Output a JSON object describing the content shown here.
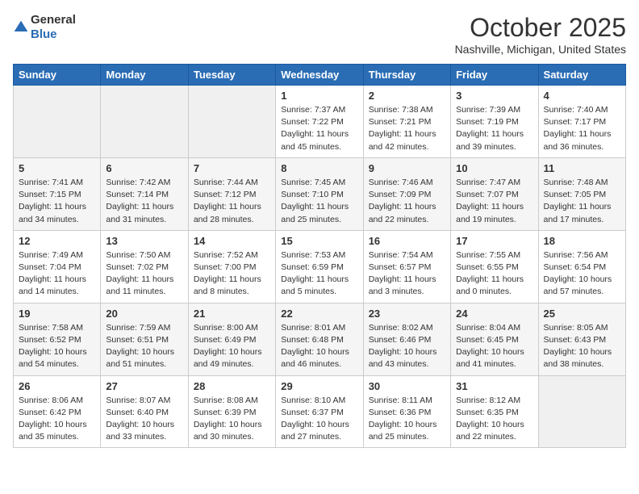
{
  "header": {
    "logo_general": "General",
    "logo_blue": "Blue",
    "month_title": "October 2025",
    "location": "Nashville, Michigan, United States"
  },
  "weekdays": [
    "Sunday",
    "Monday",
    "Tuesday",
    "Wednesday",
    "Thursday",
    "Friday",
    "Saturday"
  ],
  "weeks": [
    [
      {
        "day": "",
        "sunrise": "",
        "sunset": "",
        "daylight": ""
      },
      {
        "day": "",
        "sunrise": "",
        "sunset": "",
        "daylight": ""
      },
      {
        "day": "",
        "sunrise": "",
        "sunset": "",
        "daylight": ""
      },
      {
        "day": "1",
        "sunrise": "Sunrise: 7:37 AM",
        "sunset": "Sunset: 7:22 PM",
        "daylight": "Daylight: 11 hours and 45 minutes."
      },
      {
        "day": "2",
        "sunrise": "Sunrise: 7:38 AM",
        "sunset": "Sunset: 7:21 PM",
        "daylight": "Daylight: 11 hours and 42 minutes."
      },
      {
        "day": "3",
        "sunrise": "Sunrise: 7:39 AM",
        "sunset": "Sunset: 7:19 PM",
        "daylight": "Daylight: 11 hours and 39 minutes."
      },
      {
        "day": "4",
        "sunrise": "Sunrise: 7:40 AM",
        "sunset": "Sunset: 7:17 PM",
        "daylight": "Daylight: 11 hours and 36 minutes."
      }
    ],
    [
      {
        "day": "5",
        "sunrise": "Sunrise: 7:41 AM",
        "sunset": "Sunset: 7:15 PM",
        "daylight": "Daylight: 11 hours and 34 minutes."
      },
      {
        "day": "6",
        "sunrise": "Sunrise: 7:42 AM",
        "sunset": "Sunset: 7:14 PM",
        "daylight": "Daylight: 11 hours and 31 minutes."
      },
      {
        "day": "7",
        "sunrise": "Sunrise: 7:44 AM",
        "sunset": "Sunset: 7:12 PM",
        "daylight": "Daylight: 11 hours and 28 minutes."
      },
      {
        "day": "8",
        "sunrise": "Sunrise: 7:45 AM",
        "sunset": "Sunset: 7:10 PM",
        "daylight": "Daylight: 11 hours and 25 minutes."
      },
      {
        "day": "9",
        "sunrise": "Sunrise: 7:46 AM",
        "sunset": "Sunset: 7:09 PM",
        "daylight": "Daylight: 11 hours and 22 minutes."
      },
      {
        "day": "10",
        "sunrise": "Sunrise: 7:47 AM",
        "sunset": "Sunset: 7:07 PM",
        "daylight": "Daylight: 11 hours and 19 minutes."
      },
      {
        "day": "11",
        "sunrise": "Sunrise: 7:48 AM",
        "sunset": "Sunset: 7:05 PM",
        "daylight": "Daylight: 11 hours and 17 minutes."
      }
    ],
    [
      {
        "day": "12",
        "sunrise": "Sunrise: 7:49 AM",
        "sunset": "Sunset: 7:04 PM",
        "daylight": "Daylight: 11 hours and 14 minutes."
      },
      {
        "day": "13",
        "sunrise": "Sunrise: 7:50 AM",
        "sunset": "Sunset: 7:02 PM",
        "daylight": "Daylight: 11 hours and 11 minutes."
      },
      {
        "day": "14",
        "sunrise": "Sunrise: 7:52 AM",
        "sunset": "Sunset: 7:00 PM",
        "daylight": "Daylight: 11 hours and 8 minutes."
      },
      {
        "day": "15",
        "sunrise": "Sunrise: 7:53 AM",
        "sunset": "Sunset: 6:59 PM",
        "daylight": "Daylight: 11 hours and 5 minutes."
      },
      {
        "day": "16",
        "sunrise": "Sunrise: 7:54 AM",
        "sunset": "Sunset: 6:57 PM",
        "daylight": "Daylight: 11 hours and 3 minutes."
      },
      {
        "day": "17",
        "sunrise": "Sunrise: 7:55 AM",
        "sunset": "Sunset: 6:55 PM",
        "daylight": "Daylight: 11 hours and 0 minutes."
      },
      {
        "day": "18",
        "sunrise": "Sunrise: 7:56 AM",
        "sunset": "Sunset: 6:54 PM",
        "daylight": "Daylight: 10 hours and 57 minutes."
      }
    ],
    [
      {
        "day": "19",
        "sunrise": "Sunrise: 7:58 AM",
        "sunset": "Sunset: 6:52 PM",
        "daylight": "Daylight: 10 hours and 54 minutes."
      },
      {
        "day": "20",
        "sunrise": "Sunrise: 7:59 AM",
        "sunset": "Sunset: 6:51 PM",
        "daylight": "Daylight: 10 hours and 51 minutes."
      },
      {
        "day": "21",
        "sunrise": "Sunrise: 8:00 AM",
        "sunset": "Sunset: 6:49 PM",
        "daylight": "Daylight: 10 hours and 49 minutes."
      },
      {
        "day": "22",
        "sunrise": "Sunrise: 8:01 AM",
        "sunset": "Sunset: 6:48 PM",
        "daylight": "Daylight: 10 hours and 46 minutes."
      },
      {
        "day": "23",
        "sunrise": "Sunrise: 8:02 AM",
        "sunset": "Sunset: 6:46 PM",
        "daylight": "Daylight: 10 hours and 43 minutes."
      },
      {
        "day": "24",
        "sunrise": "Sunrise: 8:04 AM",
        "sunset": "Sunset: 6:45 PM",
        "daylight": "Daylight: 10 hours and 41 minutes."
      },
      {
        "day": "25",
        "sunrise": "Sunrise: 8:05 AM",
        "sunset": "Sunset: 6:43 PM",
        "daylight": "Daylight: 10 hours and 38 minutes."
      }
    ],
    [
      {
        "day": "26",
        "sunrise": "Sunrise: 8:06 AM",
        "sunset": "Sunset: 6:42 PM",
        "daylight": "Daylight: 10 hours and 35 minutes."
      },
      {
        "day": "27",
        "sunrise": "Sunrise: 8:07 AM",
        "sunset": "Sunset: 6:40 PM",
        "daylight": "Daylight: 10 hours and 33 minutes."
      },
      {
        "day": "28",
        "sunrise": "Sunrise: 8:08 AM",
        "sunset": "Sunset: 6:39 PM",
        "daylight": "Daylight: 10 hours and 30 minutes."
      },
      {
        "day": "29",
        "sunrise": "Sunrise: 8:10 AM",
        "sunset": "Sunset: 6:37 PM",
        "daylight": "Daylight: 10 hours and 27 minutes."
      },
      {
        "day": "30",
        "sunrise": "Sunrise: 8:11 AM",
        "sunset": "Sunset: 6:36 PM",
        "daylight": "Daylight: 10 hours and 25 minutes."
      },
      {
        "day": "31",
        "sunrise": "Sunrise: 8:12 AM",
        "sunset": "Sunset: 6:35 PM",
        "daylight": "Daylight: 10 hours and 22 minutes."
      },
      {
        "day": "",
        "sunrise": "",
        "sunset": "",
        "daylight": ""
      }
    ]
  ]
}
